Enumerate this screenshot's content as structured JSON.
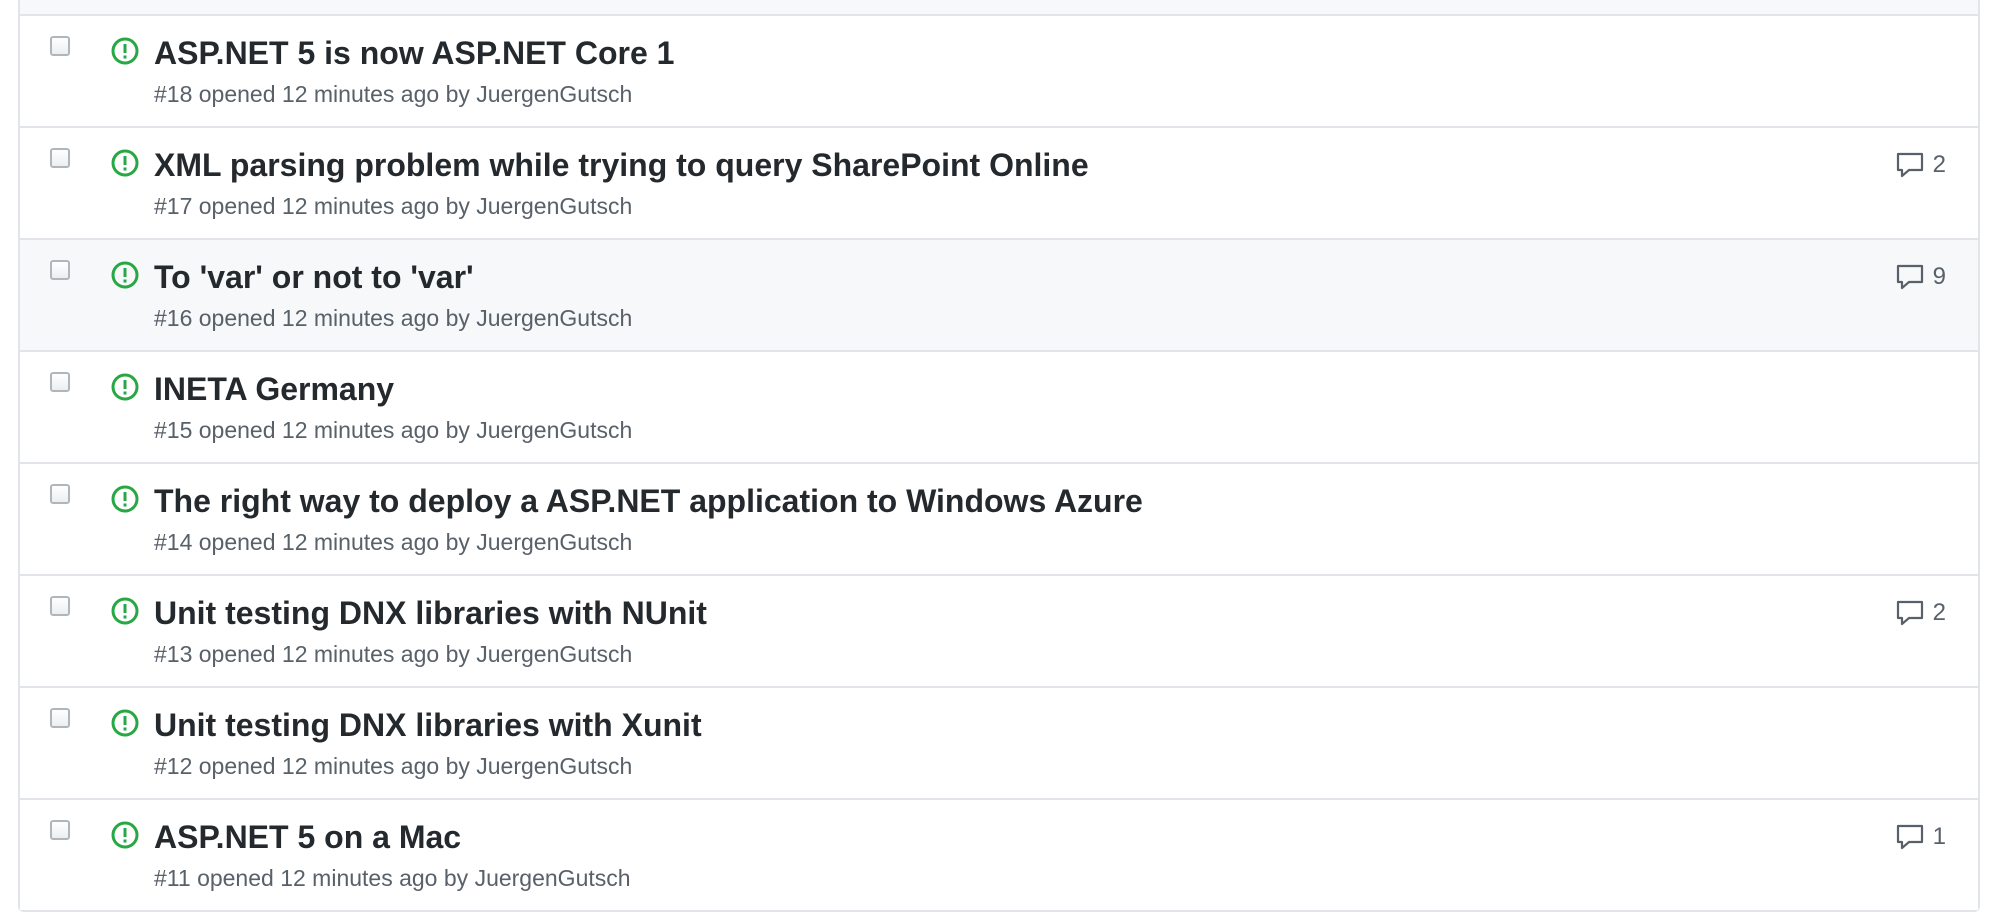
{
  "colors": {
    "open_icon": "#28a745",
    "title": "#24292e",
    "meta": "#586069",
    "border": "#e1e4e8"
  },
  "issues": [
    {
      "title": "ASP.NET 5 is now ASP.NET Core 1",
      "number": "#18",
      "opened": "opened 12 minutes ago",
      "by": "by",
      "author": "JuergenGutsch",
      "comments": ""
    },
    {
      "title": "XML parsing problem while trying to query SharePoint Online",
      "number": "#17",
      "opened": "opened 12 minutes ago",
      "by": "by",
      "author": "JuergenGutsch",
      "comments": "2"
    },
    {
      "title": "To 'var' or not to 'var'",
      "number": "#16",
      "opened": "opened 12 minutes ago",
      "by": "by",
      "author": "JuergenGutsch",
      "comments": "9"
    },
    {
      "title": "INETA Germany",
      "number": "#15",
      "opened": "opened 12 minutes ago",
      "by": "by",
      "author": "JuergenGutsch",
      "comments": ""
    },
    {
      "title": "The right way to deploy a ASP.NET application to Windows Azure",
      "number": "#14",
      "opened": "opened 12 minutes ago",
      "by": "by",
      "author": "JuergenGutsch",
      "comments": ""
    },
    {
      "title": "Unit testing DNX libraries with NUnit",
      "number": "#13",
      "opened": "opened 12 minutes ago",
      "by": "by",
      "author": "JuergenGutsch",
      "comments": "2"
    },
    {
      "title": "Unit testing DNX libraries with Xunit",
      "number": "#12",
      "opened": "opened 12 minutes ago",
      "by": "by",
      "author": "JuergenGutsch",
      "comments": ""
    },
    {
      "title": "ASP.NET 5 on a Mac",
      "number": "#11",
      "opened": "opened 12 minutes ago",
      "by": "by",
      "author": "JuergenGutsch",
      "comments": "1"
    }
  ]
}
